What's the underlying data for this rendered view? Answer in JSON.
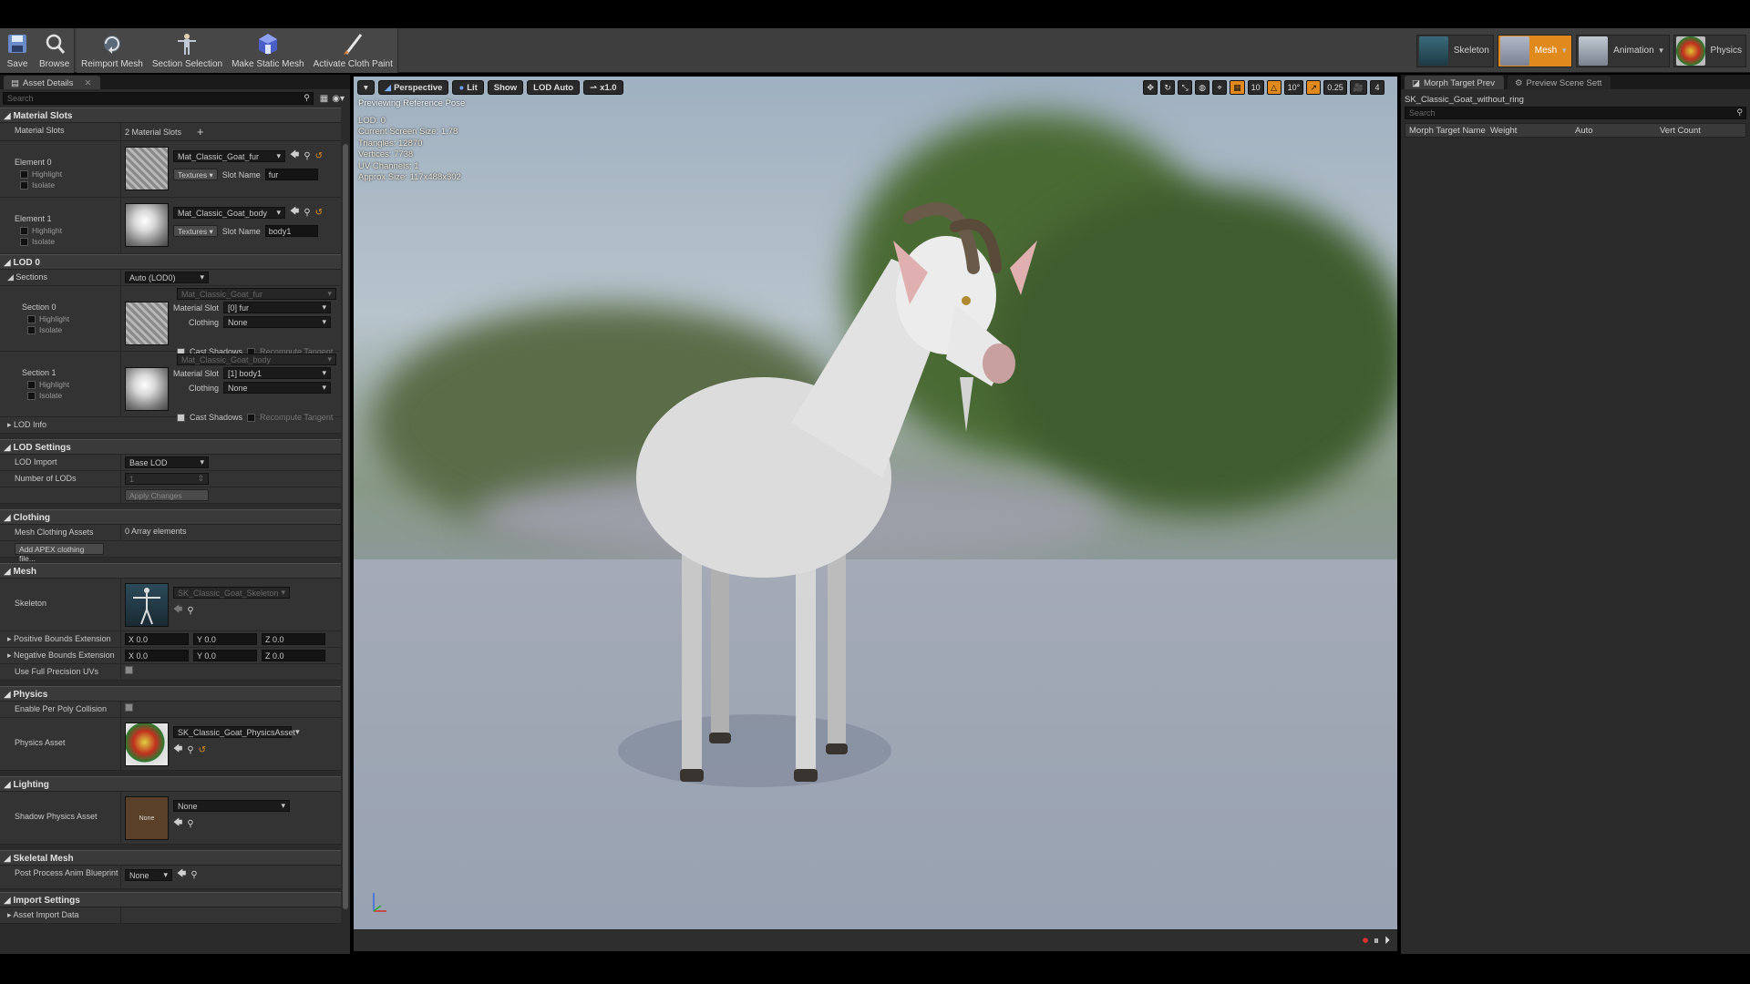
{
  "toolbar": {
    "buttons": [
      {
        "label": "Save",
        "icon": "save-icon"
      },
      {
        "label": "Browse",
        "icon": "browse-icon"
      },
      {
        "label": "Reimport Mesh",
        "icon": "reimport-icon"
      },
      {
        "label": "Section Selection",
        "icon": "section-selection-icon"
      },
      {
        "label": "Make Static Mesh",
        "icon": "static-mesh-icon"
      },
      {
        "label": "Activate Cloth Paint",
        "icon": "cloth-paint-icon"
      }
    ],
    "modes": [
      {
        "label": "Skeleton",
        "active": false
      },
      {
        "label": "Mesh",
        "active": true
      },
      {
        "label": "Animation",
        "active": false
      },
      {
        "label": "Physics",
        "active": false
      }
    ]
  },
  "details": {
    "tab": "Asset Details",
    "search_placeholder": "Search",
    "material_slots": {
      "title": "Material Slots",
      "label": "Material Slots",
      "count": "2 Material Slots",
      "elements": [
        {
          "name": "Element 0",
          "highlight": "Highlight",
          "isolate": "Isolate",
          "material": "Mat_Classic_Goat_fur",
          "textures": "Textures",
          "slot_name_label": "Slot Name",
          "slot_name": "fur"
        },
        {
          "name": "Element 1",
          "highlight": "Highlight",
          "isolate": "Isolate",
          "material": "Mat_Classic_Goat_body",
          "textures": "Textures",
          "slot_name_label": "Slot Name",
          "slot_name": "body1"
        }
      ]
    },
    "lod0": {
      "title": "LOD 0",
      "sections_label": "Sections",
      "sections_value": "Auto (LOD0)",
      "sections": [
        {
          "name": "Section 0",
          "highlight": "Highlight",
          "isolate": "Isolate",
          "material": "Mat_Classic_Goat_fur",
          "material_slot_label": "Material Slot",
          "material_slot": "[0] fur",
          "clothing_label": "Clothing",
          "clothing": "None",
          "cast_shadows": "Cast Shadows",
          "recompute_tangent": "Recompute Tangent"
        },
        {
          "name": "Section 1",
          "highlight": "Highlight",
          "isolate": "Isolate",
          "material": "Mat_Classic_Goat_body",
          "material_slot_label": "Material Slot",
          "material_slot": "[1] body1",
          "clothing_label": "Clothing",
          "clothing": "None",
          "cast_shadows": "Cast Shadows",
          "recompute_tangent": "Recompute Tangent"
        }
      ],
      "lod_info": "LOD Info"
    },
    "lod_settings": {
      "title": "LOD Settings",
      "lod_import_label": "LOD Import",
      "lod_import": "Base LOD",
      "num_lods_label": "Number of LODs",
      "num_lods": "1",
      "apply": "Apply Changes"
    },
    "clothing": {
      "title": "Clothing",
      "assets_label": "Mesh Clothing Assets",
      "assets_value": "0 Array elements",
      "add_button": "Add APEX clothing file..."
    },
    "mesh": {
      "title": "Mesh",
      "skeleton_label": "Skeleton",
      "skeleton": "SK_Classic_Goat_Skeleton",
      "pos_bounds_label": "Positive Bounds Extension",
      "neg_bounds_label": "Negative Bounds Extension",
      "bounds": {
        "x": "X 0.0",
        "y": "Y 0.0",
        "z": "Z 0.0"
      },
      "full_precision_label": "Use Full Precision UVs"
    },
    "physics": {
      "title": "Physics",
      "per_poly_label": "Enable Per Poly Collision",
      "asset_label": "Physics Asset",
      "asset": "SK_Classic_Goat_PhysicsAsset"
    },
    "lighting": {
      "title": "Lighting",
      "shadow_label": "Shadow Physics Asset",
      "shadow_value": "None",
      "thumb_text": "None"
    },
    "skeletal_mesh": {
      "title": "Skeletal Mesh",
      "post_process_label": "Post Process Anim Blueprint",
      "post_process": "None"
    },
    "import_settings": {
      "title": "Import Settings",
      "asset_import_data": "Asset Import Data"
    }
  },
  "viewport": {
    "menu": "▾",
    "perspective": "Perspective",
    "lit": "Lit",
    "show": "Show",
    "lod": "LOD Auto",
    "speed": "x1.0",
    "grid_snap": "10",
    "rot_snap": "10°",
    "scale_snap": "0.25",
    "cam_speed": "4",
    "info_title": "Previewing Reference Pose",
    "stats": [
      "LOD: 0",
      "Current Screen Size: 1.78",
      "Triangles: 12870",
      "Vertices: 7738",
      "UV Channels: 1",
      "Approx Size: 117x488x302"
    ]
  },
  "morph_panel": {
    "tabs": [
      "Morph Target Prev",
      "Preview Scene Sett"
    ],
    "asset_name": "SK_Classic_Goat_without_ring",
    "search_placeholder": "Search",
    "columns": [
      "Morph Target Name",
      "Weight",
      "Auto",
      "Vert Count"
    ]
  },
  "colors": {
    "accent": "#e08a1e",
    "panel_bg": "#2b2b2b",
    "toolbar_bg": "#3e3e3e"
  }
}
